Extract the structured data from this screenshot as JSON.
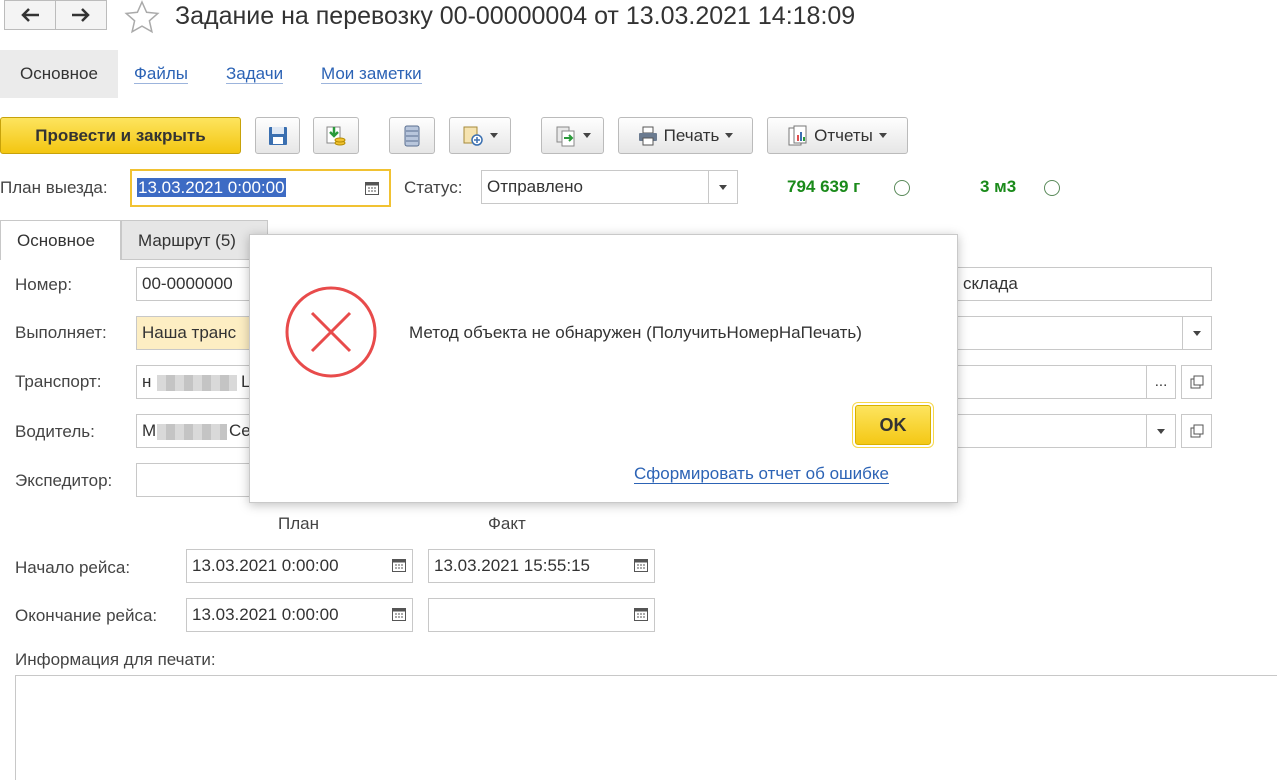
{
  "header": {
    "title": "Задание на перевозку 00-00000004 от 13.03.2021 14:18:09"
  },
  "sections": {
    "main": "Основное",
    "files": "Файлы",
    "tasks": "Задачи",
    "notes": "Мои заметки"
  },
  "toolbar": {
    "post_close": "Провести и закрыть",
    "print": "Печать",
    "reports": "Отчеты"
  },
  "top": {
    "plan_label": "План выезда:",
    "plan_value": "13.03.2021  0:00:00",
    "status_label": "Статус:",
    "status_value": "Отправлено",
    "weight": "794 639 г",
    "volume": "3 м3"
  },
  "form_tabs": {
    "main": "Основное",
    "route": "Маршрут (5)"
  },
  "fields": {
    "number_label": "Номер:",
    "number_value": "00-0000000",
    "warehouse_value": "склада",
    "performer_label": "Выполняет:",
    "performer_value": "Наша транс",
    "transport_label": "Транспорт:",
    "transport_prefix": "н",
    "transport_suffix": "Ц",
    "driver_label": "Водитель:",
    "driver_prefix": "М",
    "driver_suffix": "Се",
    "forwarder_label": "Экспедитор:",
    "plan_header": "План",
    "fact_header": "Факт",
    "start_label": "Начало рейса:",
    "start_plan": "13.03.2021  0:00:00",
    "start_fact": "13.03.2021 15:55:15",
    "end_label": "Окончание рейса:",
    "end_plan": "13.03.2021  0:00:00",
    "end_fact": "  .  .       :  :",
    "print_info_label": "Информация для печати:",
    "more_dots": "..."
  },
  "dialog": {
    "message": "Метод объекта не обнаружен (ПолучитьНомерНаПечать)",
    "ok": "OK",
    "report_link": "Сформировать отчет об ошибке"
  },
  "colors": {
    "accent_yellow": "#f5c815",
    "link": "#2c63b5",
    "green": "#1a8a1a",
    "error_red": "#e84b4b"
  }
}
